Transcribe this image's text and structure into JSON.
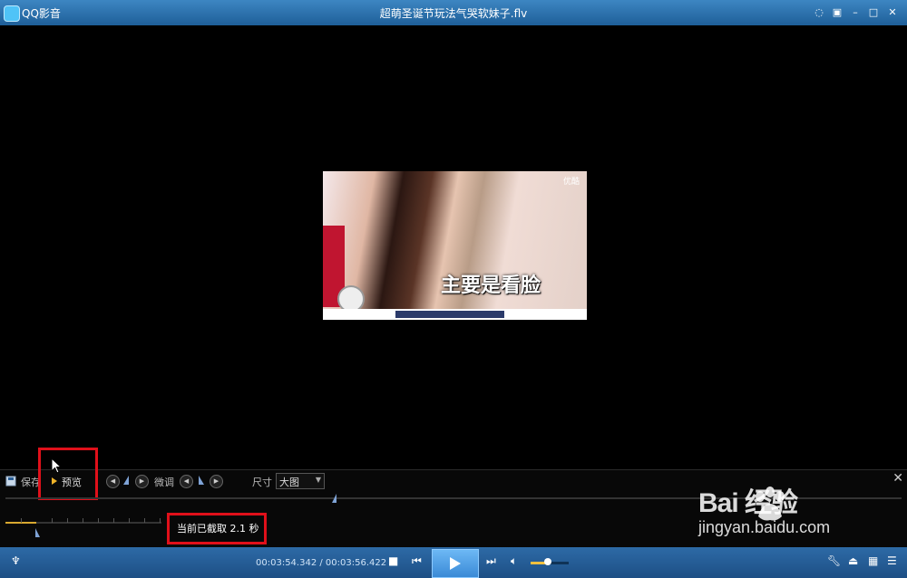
{
  "titlebar": {
    "app_name": "QQ影音",
    "window_title": "超萌圣诞节玩法气哭软妹子.flv",
    "buttons": [
      "message-icon",
      "skin-icon",
      "minimize-icon",
      "maximize-icon",
      "close-icon"
    ]
  },
  "video": {
    "corner_logo": "优酷",
    "caption": "主要是看脸"
  },
  "cut_toolbar": {
    "save_label": "保存",
    "preview_label": "预览",
    "fine_tune_label": "微调",
    "size_label": "尺寸",
    "size_value": "大图",
    "elapsed_text": "当前已截取 2.1 秒"
  },
  "bottombar": {
    "timecode": "00:03:54.342 / 00:03:56.422",
    "volume_fraction": 0.45
  },
  "watermark": {
    "brand": "Bai 经验",
    "url": "jingyan.baidu.com"
  },
  "colors": {
    "title_bar": "#2f74b3",
    "highlight_box": "#e0101a",
    "play_button": "#4a9ae3",
    "accent": "#d8a830"
  }
}
